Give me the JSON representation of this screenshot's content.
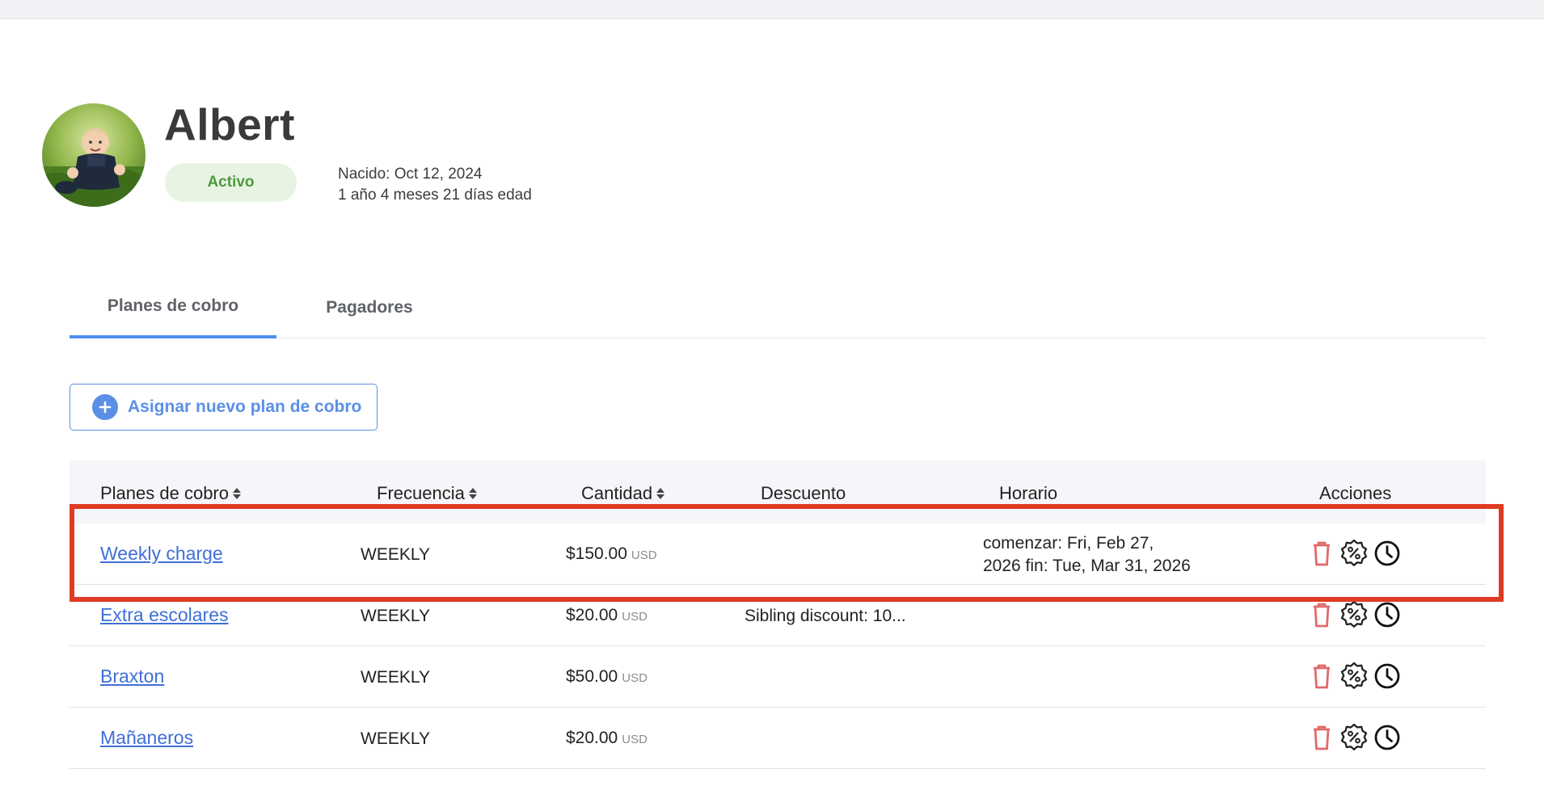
{
  "child": {
    "name": "Albert",
    "status": "Activo",
    "birth_line": "Nacido: Oct 12, 2024",
    "age_line": "1 año 4 meses 21 días edad"
  },
  "tabs": [
    {
      "label": "Planes de cobro",
      "active": true
    },
    {
      "label": "Pagadores",
      "active": false
    }
  ],
  "assign_button": {
    "label": "Asignar nuevo plan de cobro",
    "icon": "plus-circle-icon"
  },
  "table": {
    "columns": [
      "Planes de cobro",
      "Frecuencia",
      "Cantidad",
      "Descuento",
      "Horario",
      "Acciones"
    ],
    "rows": [
      {
        "plan": "Weekly charge",
        "frequency": "WEEKLY",
        "amount": "$150.00",
        "currency": "USD",
        "discount": "",
        "schedule_line1": "comenzar: Fri, Feb 27,",
        "schedule_line2": "2026 fin: Tue, Mar 31, 2026"
      },
      {
        "plan": "Extra escolares",
        "frequency": "WEEKLY",
        "amount": "$20.00",
        "currency": "USD",
        "discount": "Sibling discount: 10...",
        "schedule_line1": "",
        "schedule_line2": ""
      },
      {
        "plan": "Braxton",
        "frequency": "WEEKLY",
        "amount": "$50.00",
        "currency": "USD",
        "discount": "",
        "schedule_line1": "",
        "schedule_line2": ""
      },
      {
        "plan": "Mañaneros",
        "frequency": "WEEKLY",
        "amount": "$20.00",
        "currency": "USD",
        "discount": "",
        "schedule_line1": "",
        "schedule_line2": ""
      }
    ],
    "action_icons": [
      "trash-icon",
      "discount-badge-icon",
      "clock-icon"
    ]
  },
  "colors": {
    "accent": "#5b8fe6",
    "link": "#3f6fd8",
    "status_bg": "#e7f4e3",
    "status_text": "#4f9a3c",
    "delete": "#e06b6b",
    "highlight": "#e03a23"
  }
}
